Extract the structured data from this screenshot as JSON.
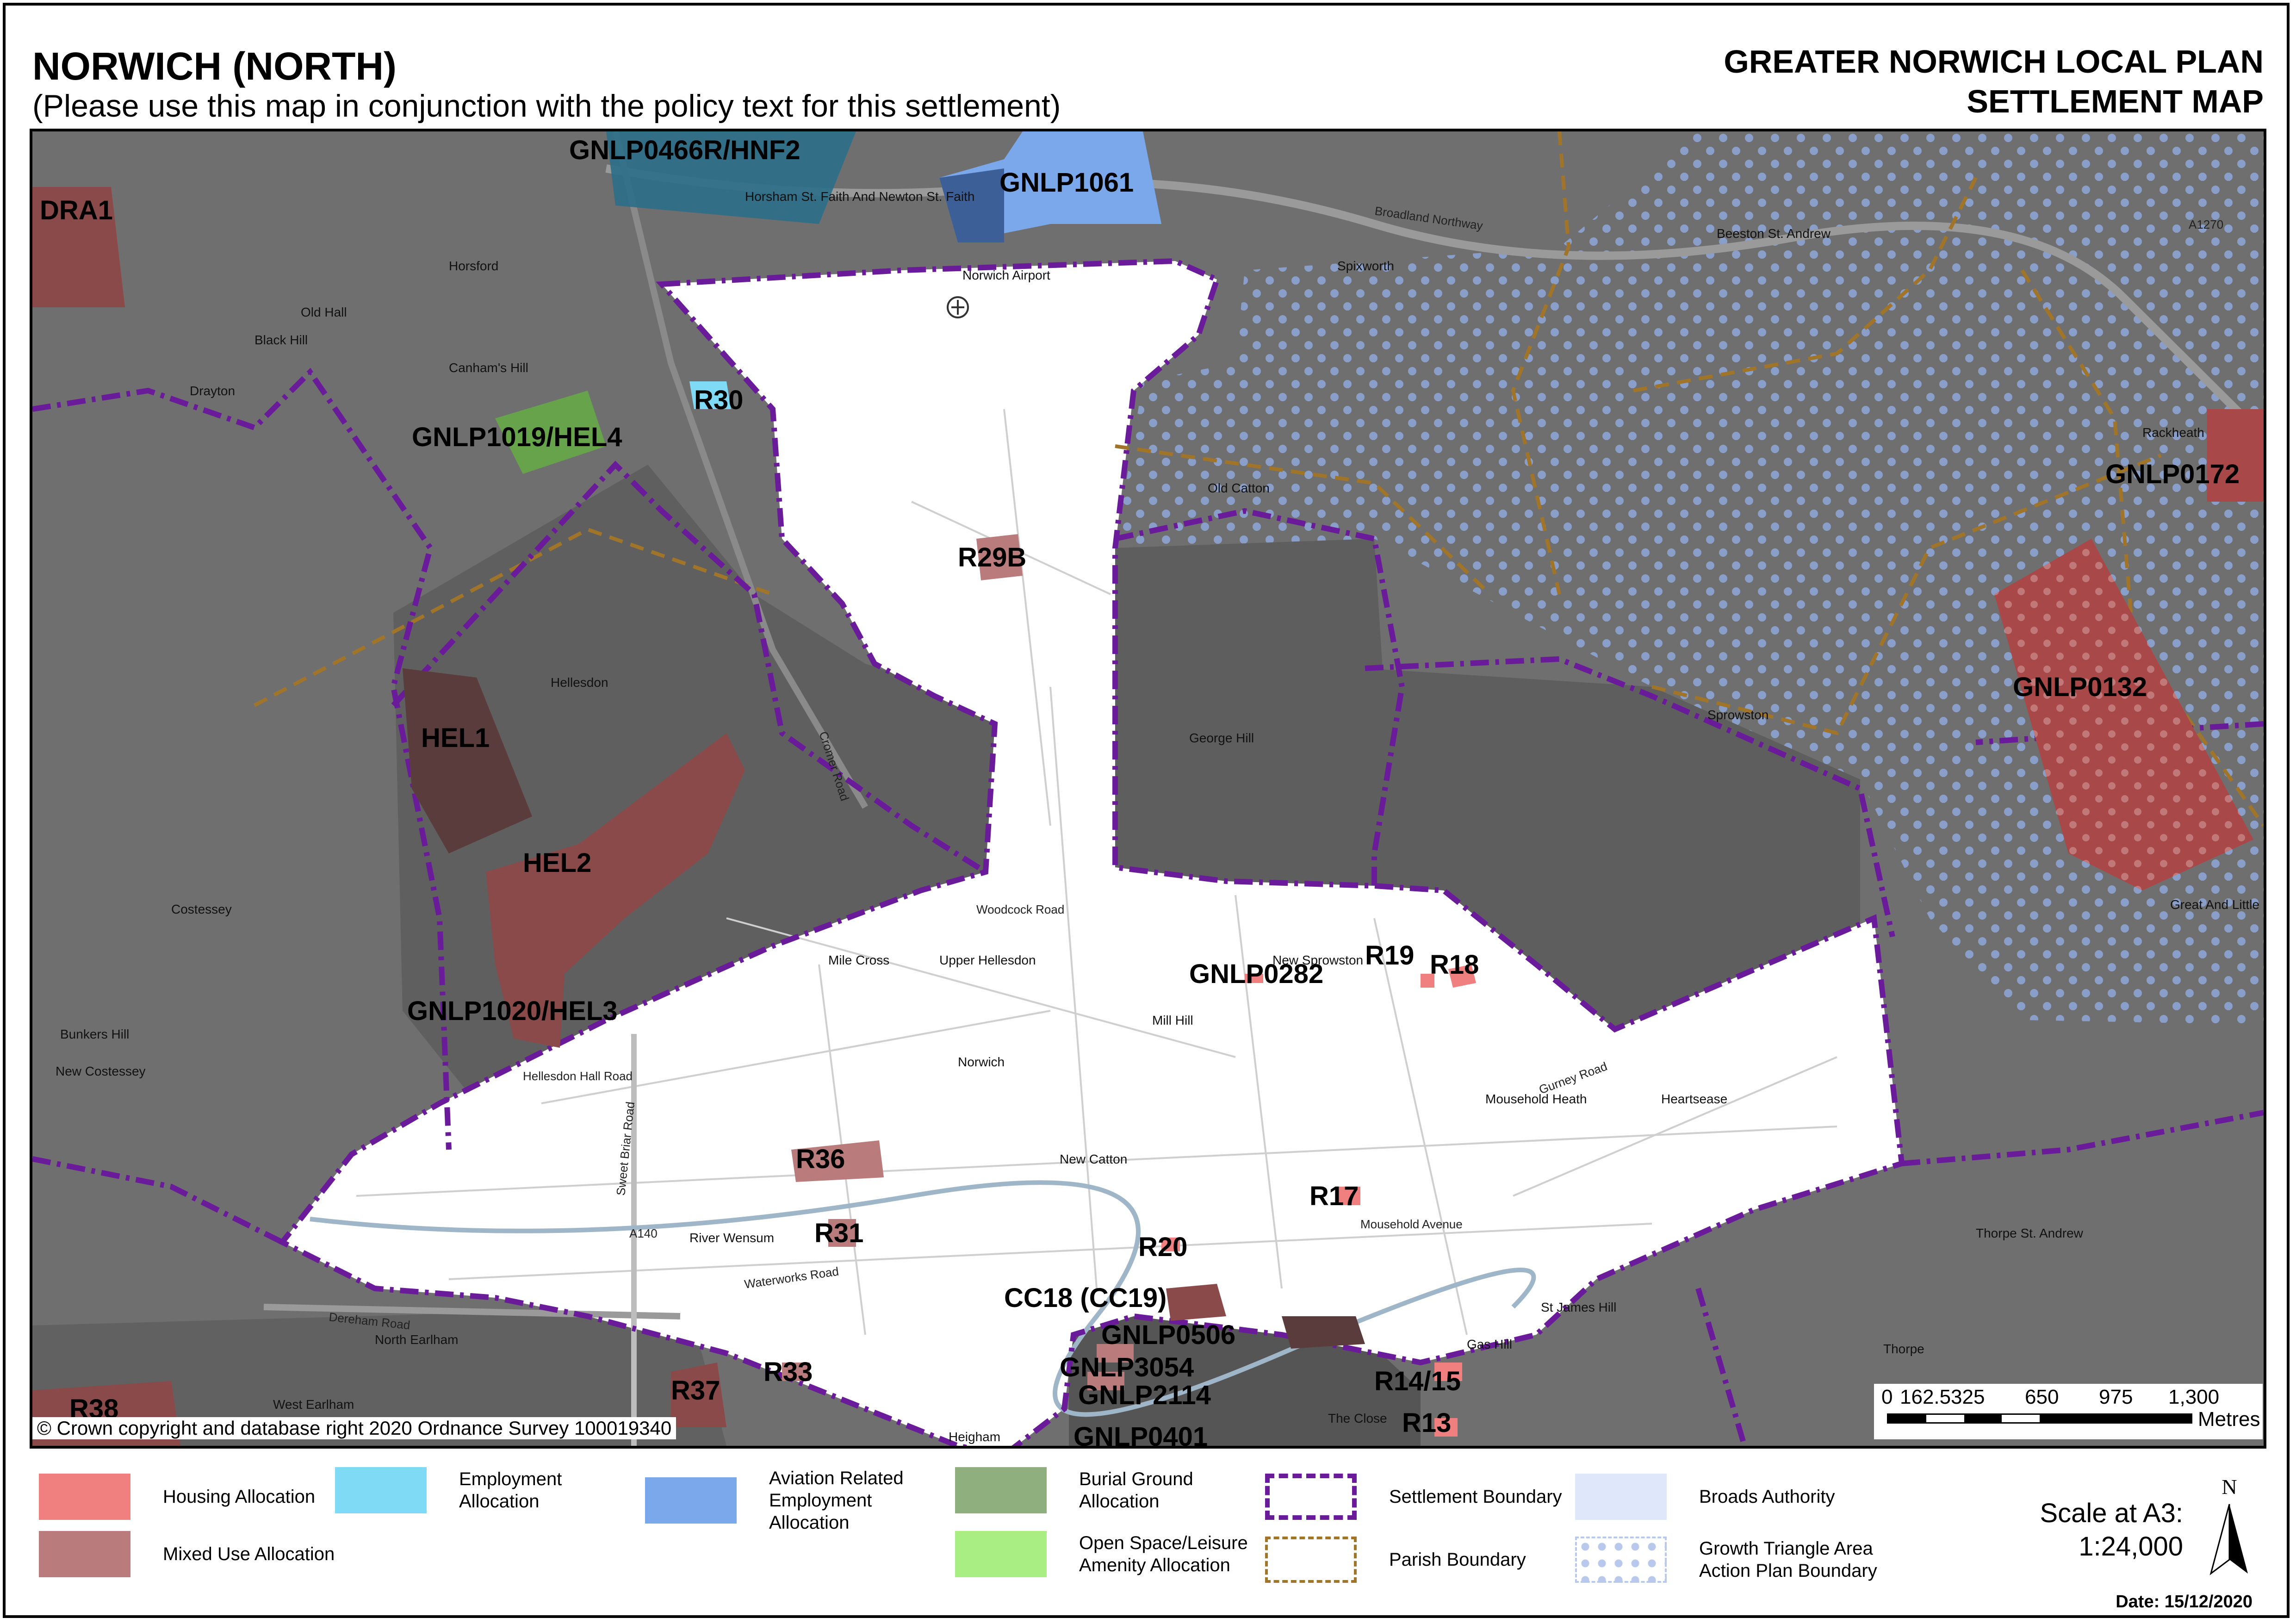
{
  "header": {
    "title": "NORWICH (NORTH)",
    "subtitle": "(Please use this map in conjunction with the policy text for this settlement)",
    "plan_line1": "GREATER NORWICH LOCAL PLAN",
    "plan_line2": "SETTLEMENT MAP"
  },
  "map": {
    "site_labels": {
      "gnlp0466r": "GNLP0466R/HNF2",
      "gnlp1061": "GNLP1061",
      "dra1": "DRA1",
      "r30": "R30",
      "gnlp1019": "GNLP1019/HEL4",
      "gnlp0172": "GNLP0172",
      "r29b": "R29B",
      "gnlp0132": "GNLP0132",
      "hel1": "HEL1",
      "hel2": "HEL2",
      "r19": "R19",
      "r18": "R18",
      "gnlp0282": "GNLP0282",
      "gnlp1020": "GNLP1020/HEL3",
      "r36": "R36",
      "r17": "R17",
      "r31": "R31",
      "r20": "R20",
      "cc18": "CC18 (CC19)",
      "gnlp0506": "GNLP0506",
      "gnlp3054": "GNLP3054",
      "gnlp2114": "GNLP2114",
      "gnlp0401": "GNLP0401",
      "r33": "R33",
      "r37": "R37",
      "r38": "R38",
      "r14_15": "R14/15",
      "r13": "R13"
    },
    "place_labels": {
      "horsham": "Horsham St. Faith And Newton St. Faith",
      "horsford": "Horsford",
      "norwich_airport": "Norwich Airport",
      "spixworth": "Spixworth",
      "beeston": "Beeston St. Andrew",
      "drayton": "Drayton",
      "old_catton": "Old Catton",
      "rackheath": "Rackheath",
      "hellesdon": "Hellesdon",
      "sprowston": "Sprowston",
      "costessey": "Costessey",
      "new_costessey": "New Costessey",
      "mile_cross": "Mile Cross",
      "upper_hellesdon": "Upper Hellesdon",
      "norwich": "Norwich",
      "new_sprowston": "New Sprowston",
      "mill_hill": "Mill Hill",
      "heartsease": "Heartsease",
      "mousehold_heath": "Mousehold Heath",
      "new_catton": "New Catton",
      "river_wensum": "River Wensum",
      "thorpe_st_andrew": "Thorpe St. Andrew",
      "great_plumstead": "Great And Little Plumstead",
      "north_earlham": "North Earlham",
      "west_earlham": "West Earlham",
      "heigham": "Heigham",
      "the_close": "The Close",
      "gas_hill": "Gas Hill",
      "st_james_hill": "St James Hill",
      "george_hill": "George Hill",
      "thorpe": "Thorpe",
      "bunkers_hill": "Bunkers Hill",
      "old_hall": "Old Hall",
      "canhams_hill": "Canham's Hill",
      "black_hill": "Black Hill"
    },
    "road_labels": {
      "broadland_northway": "Broadland Northway",
      "cromer_road": "Cromer Road",
      "sweet_briar_road": "Sweet Briar Road",
      "dereham_road": "Dereham Road",
      "a140": "A140",
      "a1270": "A1270",
      "woodcock_road": "Woodcock Road",
      "mousehold_avenue": "Mousehold Avenue",
      "gurney_road": "Gurney Road",
      "hellesdon_hall_road": "Hellesdon Hall Road",
      "waterworks_road": "Waterworks Road"
    },
    "copyright": "© Crown copyright and database right 2020 Ordnance Survey 100019340"
  },
  "scalebar": {
    "ticks": [
      "0",
      "162.5",
      "325",
      "650",
      "975",
      "1,300"
    ],
    "unit": "Metres"
  },
  "legend": {
    "items": [
      {
        "label": "Housing Allocation",
        "color": "#f08080",
        "pattern": "solid"
      },
      {
        "label": "Mixed Use Allocation",
        "color": "#b97b7b",
        "pattern": "solid"
      },
      {
        "label": "Employment Allocation",
        "color": "#7fdbf5",
        "pattern": "solid"
      },
      {
        "label": "Aviation Related Employment Allocation",
        "color": "#7aa8ea",
        "pattern": "solid"
      },
      {
        "label": "Burial Ground Allocation",
        "color": "#8fb07e",
        "pattern": "solid"
      },
      {
        "label": "Open Space/Leisure Amenity Allocation",
        "color": "#a8ee82",
        "pattern": "solid"
      },
      {
        "label": "Settlement Boundary",
        "color": "#6a1b9a",
        "pattern": "dash-dot"
      },
      {
        "label": "Parish Boundary",
        "color": "#a0752a",
        "pattern": "dashed"
      },
      {
        "label": "Broads Authority",
        "color": "#dfe8fb",
        "pattern": "solid"
      },
      {
        "label": "Growth Triangle Area Action Plan Boundary",
        "color": "#b9c9ee",
        "pattern": "dots"
      }
    ],
    "scale_line1": "Scale at A3:",
    "scale_line2": "1:24,000",
    "date": "Date: 15/12/2020",
    "north": "N"
  },
  "colors": {
    "outside_grey": "#6f6f6f",
    "inside_white": "#ffffff",
    "settlement_boundary": "#6a1b9a",
    "parish_boundary": "#a0752a",
    "housing": "#f08080",
    "mixed_use": "#8a4a4a",
    "employment": "#7fdbf5",
    "aviation": "#7aa8ea",
    "burial": "#66a34a",
    "growth_dots": "#8ea7d9"
  }
}
